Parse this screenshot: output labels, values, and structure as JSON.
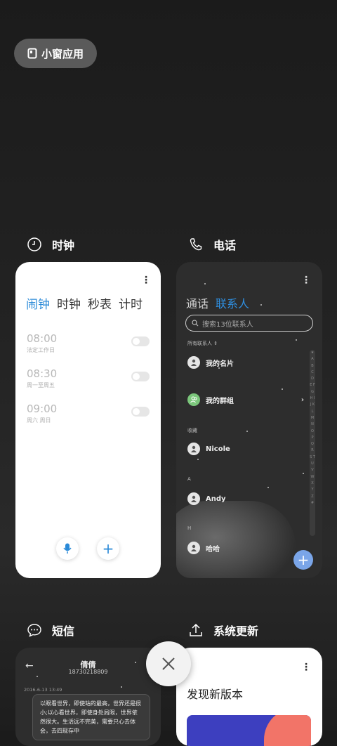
{
  "pill": {
    "label": "小窗应用"
  },
  "clock_app": {
    "title": "时钟",
    "tabs": [
      "闹钟",
      "时钟",
      "秒表",
      "计时"
    ],
    "alarms": [
      {
        "time": "08:00",
        "sub": "法定工作日"
      },
      {
        "time": "08:30",
        "sub": "周一至周五"
      },
      {
        "time": "09:00",
        "sub": "周六 周日"
      }
    ]
  },
  "phone_app": {
    "title": "电话",
    "tabs": [
      "通话",
      "联系人"
    ],
    "search_placeholder": "搜索13位联系人",
    "all_contacts_label": "所有联系人",
    "my_card": "我的名片",
    "my_group": "我的群组",
    "favorites_label": "收藏",
    "section_a": "A",
    "section_h": "H",
    "contacts": [
      "Nicole",
      "Andy",
      "哈哈"
    ],
    "alphabet": "★ A B C D E F G H I J K L M N O P Q R S T U V W X Y Z #"
  },
  "sms_app": {
    "title": "短信",
    "contact_name": "倩倩",
    "contact_number": "18730218809",
    "date": "2016-6-13 13:49",
    "message": "以眼看世界，即使站的最高，世界还是很小;以心看世界，即使身处局限，世界依然很大。生活远不完美，需要只心去体会，去四现存中"
  },
  "update_app": {
    "title": "系统更新",
    "headline": "发现新版本"
  },
  "colors": {
    "accent": "#2a8ad8",
    "fab": "#7aa5e8",
    "group_green": "#7bc67b",
    "coral": "#f27468",
    "indigo": "#3d3fbf"
  }
}
